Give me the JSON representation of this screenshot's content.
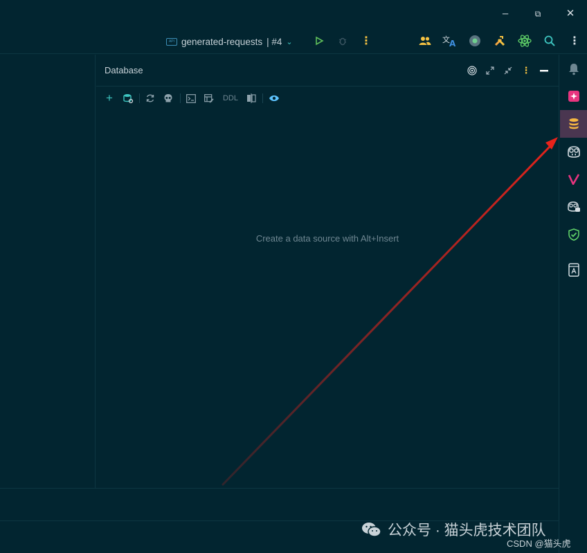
{
  "window": {
    "minimize_label": "–",
    "restore_label": "⧉",
    "close_label": "✕"
  },
  "toolbar": {
    "run_config_name": "generated-requests",
    "run_config_suffix": "| #4",
    "run_config_badge": "API"
  },
  "database_panel": {
    "title": "Database",
    "ddl_label": "DDL",
    "empty_message": "Create a data source with Alt+Insert"
  },
  "watermark": {
    "text": "公众号 · 猫头虎技术团队",
    "credit": "CSDN @猫头虎"
  },
  "colors": {
    "background": "#022530",
    "active_tool": "#4a3650",
    "accent_teal": "#3ec6c1",
    "accent_yellow": "#f5c242",
    "arrow": "#e8231b"
  }
}
